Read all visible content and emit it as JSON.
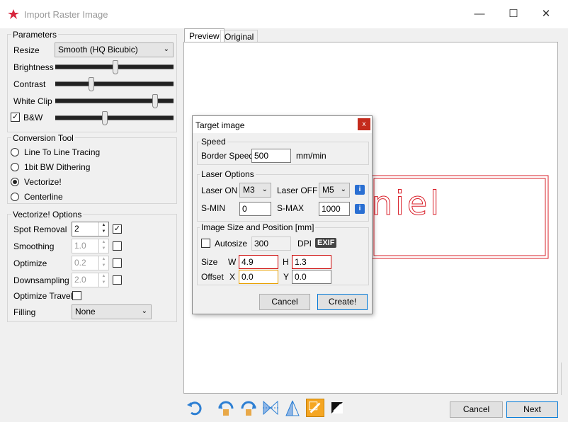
{
  "window": {
    "title": "Import Raster Image"
  },
  "parameters": {
    "group_label": "Parameters",
    "resize_label": "Resize",
    "resize_value": "Smooth (HQ Bicubic)",
    "brightness_label": "Brightness",
    "brightness_level": 0.5,
    "contrast_label": "Contrast",
    "contrast_level": 0.3,
    "whiteclip_label": "White Clip",
    "whiteclip_level": 0.85,
    "bw_label": "B&W",
    "bw_checked": true,
    "bw_level": 0.42
  },
  "conversion": {
    "group_label": "Conversion Tool",
    "options": [
      "Line To Line Tracing",
      "1bit BW Dithering",
      "Vectorize!",
      "Centerline"
    ],
    "selected": "Vectorize!"
  },
  "vectorize": {
    "group_label": "Vectorize! Options",
    "spot_removal_label": "Spot Removal",
    "spot_removal_value": "2",
    "smoothing_label": "Smoothing",
    "smoothing_value": "1.0",
    "optimize_label": "Optimize",
    "optimize_value": "0.2",
    "downsampling_label": "Downsampling",
    "downsampling_value": "2.0",
    "optimize_travel_label": "Optimize Travel",
    "filling_label": "Filling",
    "filling_value": "None"
  },
  "tabs": [
    "Preview",
    "Original"
  ],
  "preview": {
    "text": "niel"
  },
  "footer": {
    "cancel": "Cancel",
    "next": "Next"
  },
  "dialog": {
    "title": "Target image",
    "close": "x",
    "speed_group": "Speed",
    "border_speed_label": "Border Speed",
    "border_speed_value": "500",
    "speed_unit": "mm/min",
    "laser_group": "Laser Options",
    "laser_on_label": "Laser ON",
    "laser_on_value": "M3",
    "laser_off_label": "Laser OFF",
    "laser_off_value": "M5",
    "smin_label": "S-MIN",
    "smin_value": "0",
    "smax_label": "S-MAX",
    "smax_value": "1000",
    "size_group": "Image Size and Position [mm]",
    "autosize_label": "Autosize",
    "dpi_value": "300",
    "dpi_label": "DPI",
    "exif_label": "EXIF",
    "size_label": "Size",
    "w_label": "W",
    "w_value": "4.9",
    "h_label": "H",
    "h_value": "1.3",
    "offset_label": "Offset",
    "x_label": "X",
    "x_value": "0.0",
    "y_label": "Y",
    "y_value": "0.0",
    "cancel": "Cancel",
    "create": "Create!"
  },
  "colors": {
    "accent": "#0078d7",
    "close": "#c42b1c",
    "preview_line": "#d9202a"
  }
}
